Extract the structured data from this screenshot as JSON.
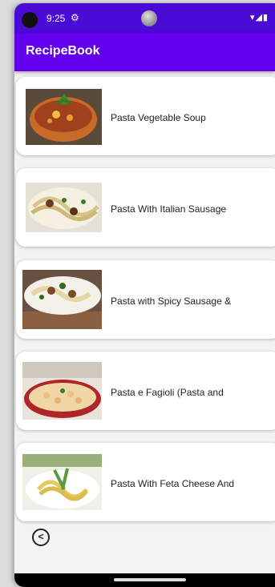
{
  "status": {
    "time": "9:25",
    "gear_glyph": "⚙",
    "icons": "▾◢▮"
  },
  "appbar": {
    "title": "RecipeBook"
  },
  "recipes": [
    {
      "title": "Pasta Vegetable Soup",
      "image_icon": "soup-bowl-photo"
    },
    {
      "title": "Pasta With Italian Sausage",
      "image_icon": "pasta-plate-photo"
    },
    {
      "title": "Pasta with Spicy Sausage &",
      "image_icon": "pasta-dish-photo"
    },
    {
      "title": "Pasta e Fagioli (Pasta and",
      "image_icon": "beans-pasta-photo"
    },
    {
      "title": "Pasta With Feta Cheese And",
      "image_icon": "spaghetti-photo"
    }
  ],
  "back_button": {
    "glyph": "<"
  },
  "colors": {
    "status_bar": "#4a0bd6",
    "app_bar": "#6200ee"
  }
}
